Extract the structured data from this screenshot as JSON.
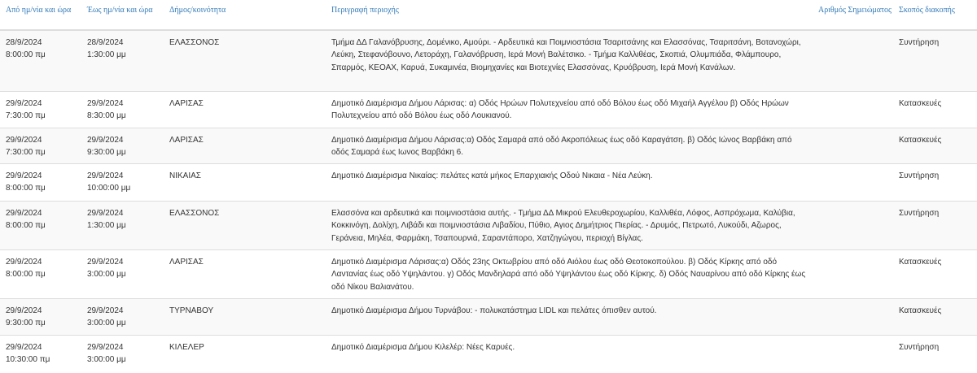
{
  "table": {
    "headers": {
      "from": "Από ημ/νία και ώρα",
      "to": "Έως ημ/νία και ώρα",
      "municipality": "Δήμος/κοινότητα",
      "description": "Περιγραφή περιοχής",
      "notice_number": "Αριθμός Σημειώματος",
      "reason": "Σκοπός διακοπής"
    },
    "rows": [
      {
        "from_date": "28/9/2024",
        "from_time": "8:00:00 πμ",
        "to_date": "28/9/2024",
        "to_time": "1:30:00 μμ",
        "municipality": "ΕΛΑΣΣΟΝΟΣ",
        "description": "Τμήμα ΔΔ Γαλανόβρυσης, Δομένικο, Αμούρι. - Αρδευτικά και Ποιμνιοστάσια Τσαριτσάνης και Ελασσόνας, Τσαριτσάνη, Βοτανοχώρι, Λεύκη, Στεφανόβουνο, Λετοράχη, Γαλανόβρυση, Ιερά Μονή Βαλέτσικο. - Τμήμα Καλλιθέας, Σκοπιά, Ολυμπιάδα, Φλάμπουρο, Σπαρμός, ΚΕΟΑΧ, Καρυά, Συκαμινέα, Βιομηχανίες και Βιοτεχνίες Ελασσόνας, Κρυόβρυση, Ιερά Μονή Κανάλων.",
        "notice_number": "",
        "reason": "Συντήρηση"
      },
      {
        "from_date": "29/9/2024",
        "from_time": "7:30:00 πμ",
        "to_date": "29/9/2024",
        "to_time": "8:30:00 μμ",
        "municipality": "ΛΑΡΙΣΑΣ",
        "description": "Δημοτικό Διαμέρισμα Δήμου Λάρισας: α) Οδός Ηρώων Πολυτεχνείου από οδό Βόλου έως οδό Μιχαήλ Αγγέλου β) Οδός Ηρώων Πολυτεχνείου από οδό Βόλου έως οδό Λουκιανού.",
        "notice_number": "",
        "reason": "Κατασκευές"
      },
      {
        "from_date": "29/9/2024",
        "from_time": "7:30:00 πμ",
        "to_date": "29/9/2024",
        "to_time": "9:30:00 μμ",
        "municipality": "ΛΑΡΙΣΑΣ",
        "description": "Δημοτικό Διαμέρισμα Δήμου Λάρισας:α) Οδός Σαμαρά από οδό Ακροπόλεως έως οδό Καραγάτση. β) Οδός Ιώνος Βαρβάκη από οδός Σαμαρά έως Ιωνος Βαρβάκη 6.",
        "notice_number": "",
        "reason": "Κατασκευές"
      },
      {
        "from_date": "29/9/2024",
        "from_time": "8:00:00 πμ",
        "to_date": "29/9/2024",
        "to_time": "10:00:00 μμ",
        "municipality": "ΝΙΚΑΙΑΣ",
        "description": "Δημοτικό Διαμέρισμα Νικαίας: πελάτες κατά μήκος Επαρχιακής Οδού Νικαια - Νέα Λεύκη.",
        "notice_number": "",
        "reason": "Συντήρηση"
      },
      {
        "from_date": "29/9/2024",
        "from_time": "8:00:00 πμ",
        "to_date": "29/9/2024",
        "to_time": "1:30:00 μμ",
        "municipality": "ΕΛΑΣΣΟΝΟΣ",
        "description": "Ελασσόνα και αρδευτικά και ποιμνιοστάσια αυτής. - Τμήμα ΔΔ Μικρού Ελευθεροχωρίου, Καλλιθέα, Λόφος, Ασπρόχωμα, Καλύβια, Κοκκινόγη, Δολίχη, Λιβάδι και ποιμνιοστάσια Λιβαδίου, Πύθιο, Αγιος Δημήτριος Πιερίας. - Δρυμός, Πετρωτό, Λυκούδι, Αζωρος, Γεράνεια, Μηλέα, Φαρμάκη, Τσαπουρνιά, Σαραντάπορο, Χατζηγώγου, περιοχή Βίγλας.",
        "notice_number": "",
        "reason": "Συντήρηση"
      },
      {
        "from_date": "29/9/2024",
        "from_time": "8:00:00 πμ",
        "to_date": "29/9/2024",
        "to_time": "3:00:00 μμ",
        "municipality": "ΛΑΡΙΣΑΣ",
        "description": "Δημοτικό Διαμέρισμα Λάρισας:α) Οδός 23ης Οκτωβρίου από οδό Αιόλου έως οδό Θεοτοκοπούλου. β) Οδός Κίρκης από οδό Λαντανίας έως οδό Υψηλάντου. γ) Οδός Μανδηλαρά από οδό Υψηλάντου έως οδό Κίρκης. δ) Οδός Ναυαρίνου από οδό Κίρκης έως οδό Νίκου Βαλιανάτου.",
        "notice_number": "",
        "reason": "Κατασκευές"
      },
      {
        "from_date": "29/9/2024",
        "from_time": "9:30:00 πμ",
        "to_date": "29/9/2024",
        "to_time": "3:00:00 μμ",
        "municipality": "ΤΥΡΝΑΒΟΥ",
        "description": "Δημοτικό Διαμέρισμα Δήμου Τυρνάβου: - πολυκατάστημα LIDL και πελάτες όπισθεν αυτού.",
        "notice_number": "",
        "reason": "Κατασκευές"
      },
      {
        "from_date": "29/9/2024",
        "from_time": "10:30:00 πμ",
        "to_date": "29/9/2024",
        "to_time": "3:00:00 μμ",
        "municipality": "ΚΙΛΕΛΕΡ",
        "description": "Δημοτικό Διαμέρισμα Δήμου Κιλελέρ: Νέες Καρυές.",
        "notice_number": "",
        "reason": "Συντήρηση"
      }
    ]
  }
}
